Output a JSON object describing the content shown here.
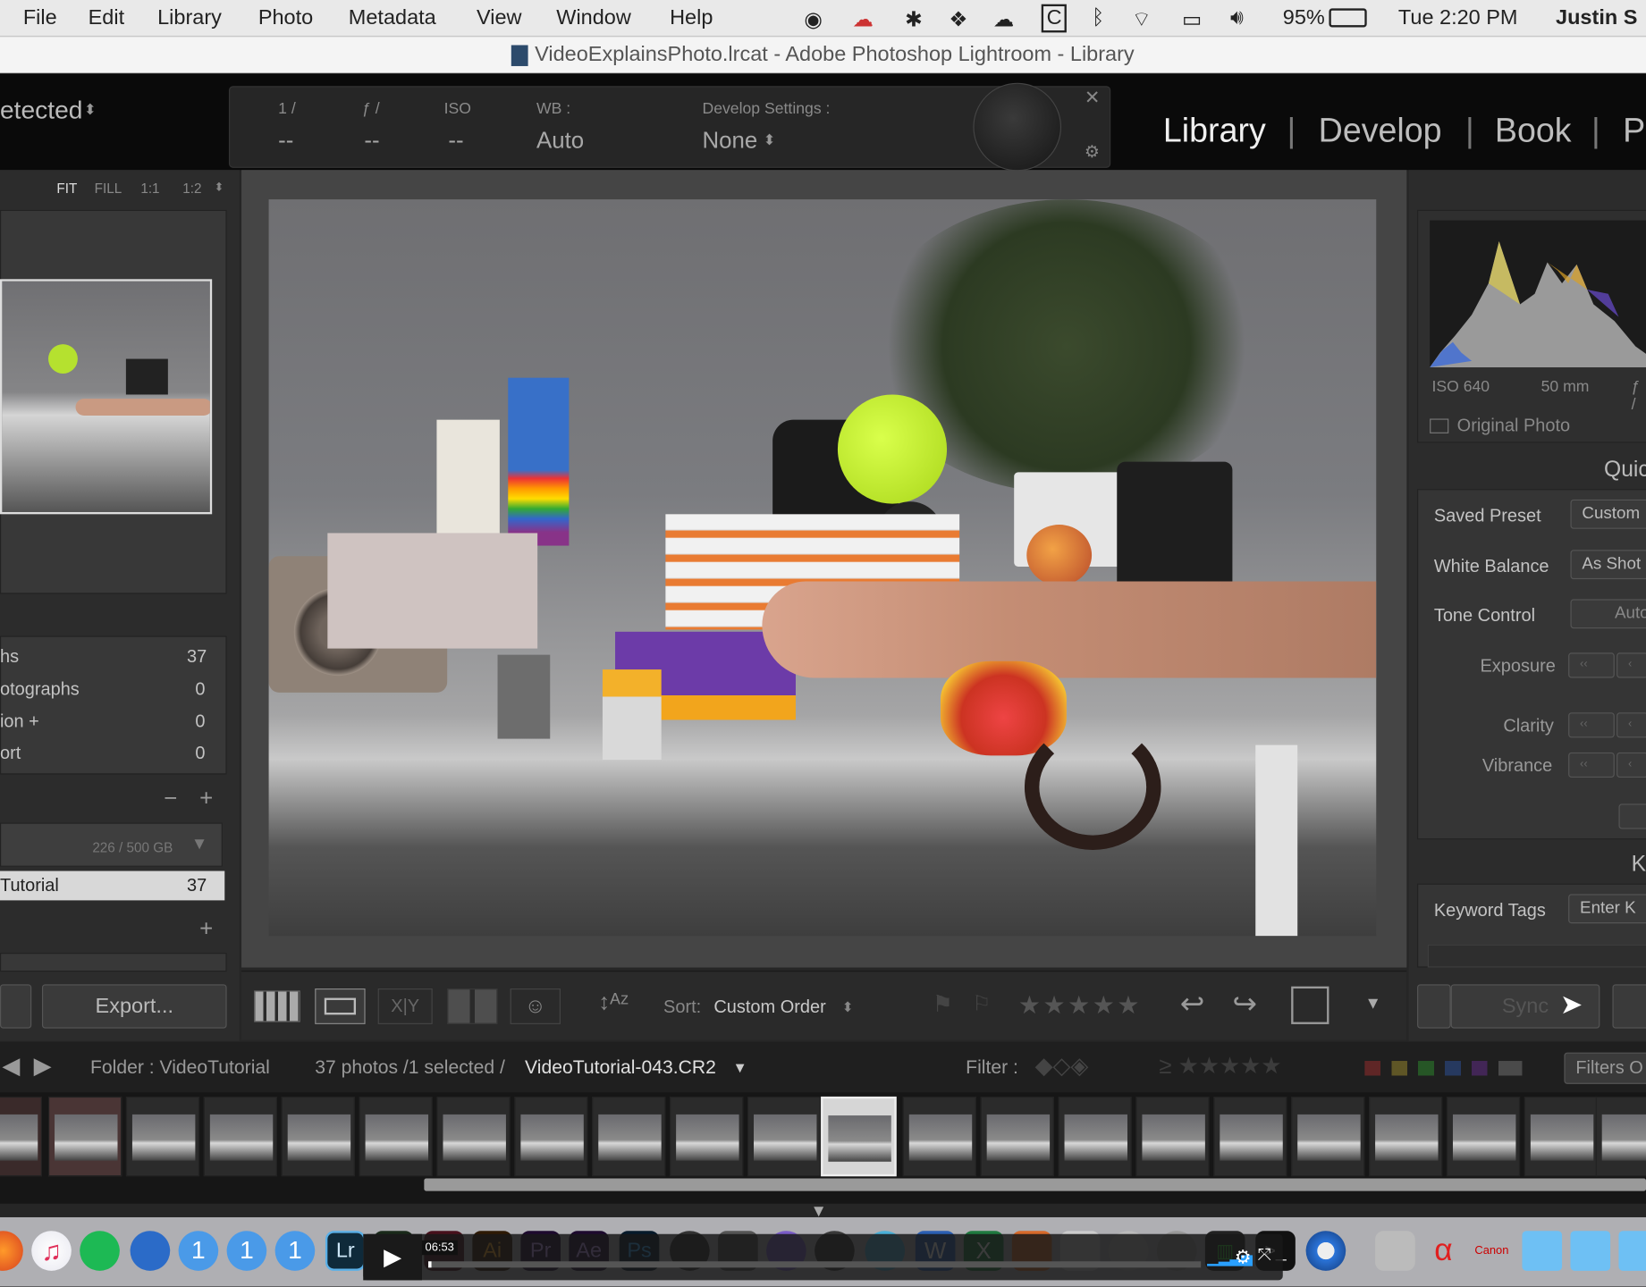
{
  "menubar": {
    "items": [
      "File",
      "Edit",
      "Library",
      "Photo",
      "Metadata",
      "View",
      "Window",
      "Help"
    ],
    "battery": "95%",
    "clock": "Tue 2:20 PM",
    "user": "Justin S"
  },
  "window": {
    "title": "VideoExplainsPhoto.lrcat - Adobe Photoshop Lightroom - Library"
  },
  "topbar": {
    "identity": "etected",
    "hud": {
      "shutter_label": "1 /",
      "shutter_value": "--",
      "aperture_label": "ƒ /",
      "aperture_value": "--",
      "iso_label": "ISO",
      "iso_value": "--",
      "wb_label": "WB :",
      "wb_value": "Auto",
      "dev_label": "Develop Settings :",
      "dev_value": "None"
    },
    "modules": [
      "Library",
      "Develop",
      "Book",
      "Pr"
    ]
  },
  "left_panel": {
    "zoom_options": [
      "FIT",
      "FILL",
      "1:1",
      "1:2"
    ],
    "catalog": [
      {
        "label": "hs",
        "count": "37"
      },
      {
        "label": "otographs",
        "count": "0"
      },
      {
        "label": "ion  +",
        "count": "0"
      },
      {
        "label": "ort",
        "count": "0"
      }
    ],
    "disk": "226 / 500 GB",
    "folder": {
      "label": "Tutorial",
      "count": "37"
    },
    "export_label": "Export..."
  },
  "right_panel": {
    "histogram": {
      "iso": "ISO 640",
      "focal": "50 mm",
      "aperture": "ƒ /"
    },
    "original_photo": "Original Photo",
    "quick_develop_header": "Quic",
    "saved_preset": {
      "label": "Saved Preset",
      "value": "Custom"
    },
    "white_balance": {
      "label": "White Balance",
      "value": "As Shot"
    },
    "tone_control": {
      "label": "Tone Control",
      "value": "Auto T"
    },
    "exposure": "Exposure",
    "clarity": "Clarity",
    "vibrance": "Vibrance",
    "keywording_header": "K",
    "keyword_tags": {
      "label": "Keyword Tags",
      "value": "Enter K"
    },
    "sync_label": "Sync"
  },
  "toolbar": {
    "sort_label": "Sort:",
    "sort_value": "Custom Order",
    "xy_label": "X|Y"
  },
  "filmstrip_bar": {
    "folder": "Folder : VideoTutorial",
    "count": "37 photos /1 selected /",
    "filename": "VideoTutorial-043.CR2",
    "filter_label": "Filter :",
    "filters_btn": "Filters O"
  },
  "video": {
    "time": "06:53"
  },
  "colors": {
    "accent": "#e8e8e8",
    "panel": "#2c2c2c",
    "center": "#454545"
  }
}
